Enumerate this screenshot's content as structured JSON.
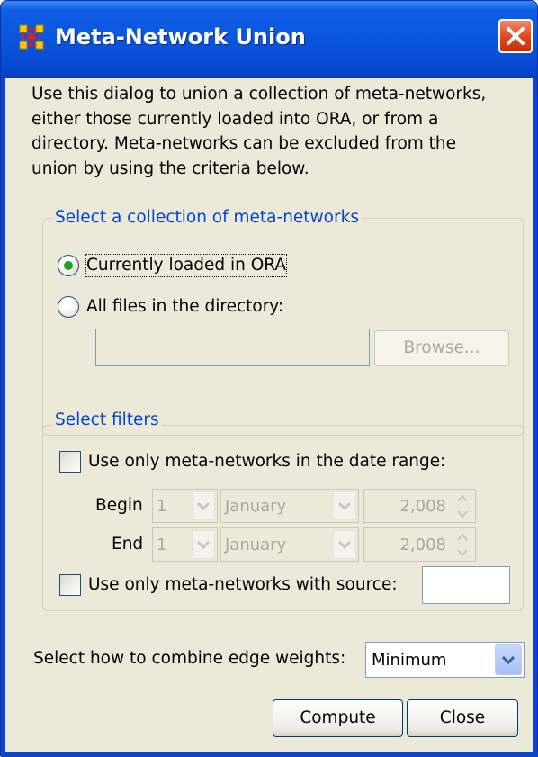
{
  "window": {
    "title": "Meta-Network Union",
    "app_icon": "network-icon",
    "close_icon": "close-icon"
  },
  "intro": {
    "lines": [
      "Use this dialog to union a collection of meta-networks,",
      "either those currently loaded into ORA, or from a",
      "directory. Meta-networks can be excluded from the",
      "union by using the criteria below."
    ]
  },
  "collection": {
    "legend": "Select a collection of meta-networks",
    "option_loaded": "Currently loaded in ORA",
    "option_directory": "All files in the directory:",
    "selected": "loaded",
    "directory_value": "",
    "browse_label": "Browse..."
  },
  "filters": {
    "legend": "Select filters",
    "date_range_label": "Use only meta-networks in the date range:",
    "date_range_checked": false,
    "begin": {
      "label": "Begin",
      "day": "1",
      "month": "January",
      "year": "2,008"
    },
    "end": {
      "label": "End",
      "day": "1",
      "month": "January",
      "year": "2,008"
    },
    "source_label": "Use only meta-networks with source:",
    "source_checked": false,
    "source_value": ""
  },
  "combine": {
    "label": "Select how to combine edge weights:",
    "value": "Minimum"
  },
  "actions": {
    "compute_label": "Compute",
    "close_label": "Close"
  },
  "colors": {
    "titlebar": "#0a55de",
    "client_bg": "#ece9d8",
    "legend_text": "#0046d5",
    "close_button": "#e0441e",
    "radio_dot": "#21a121"
  }
}
